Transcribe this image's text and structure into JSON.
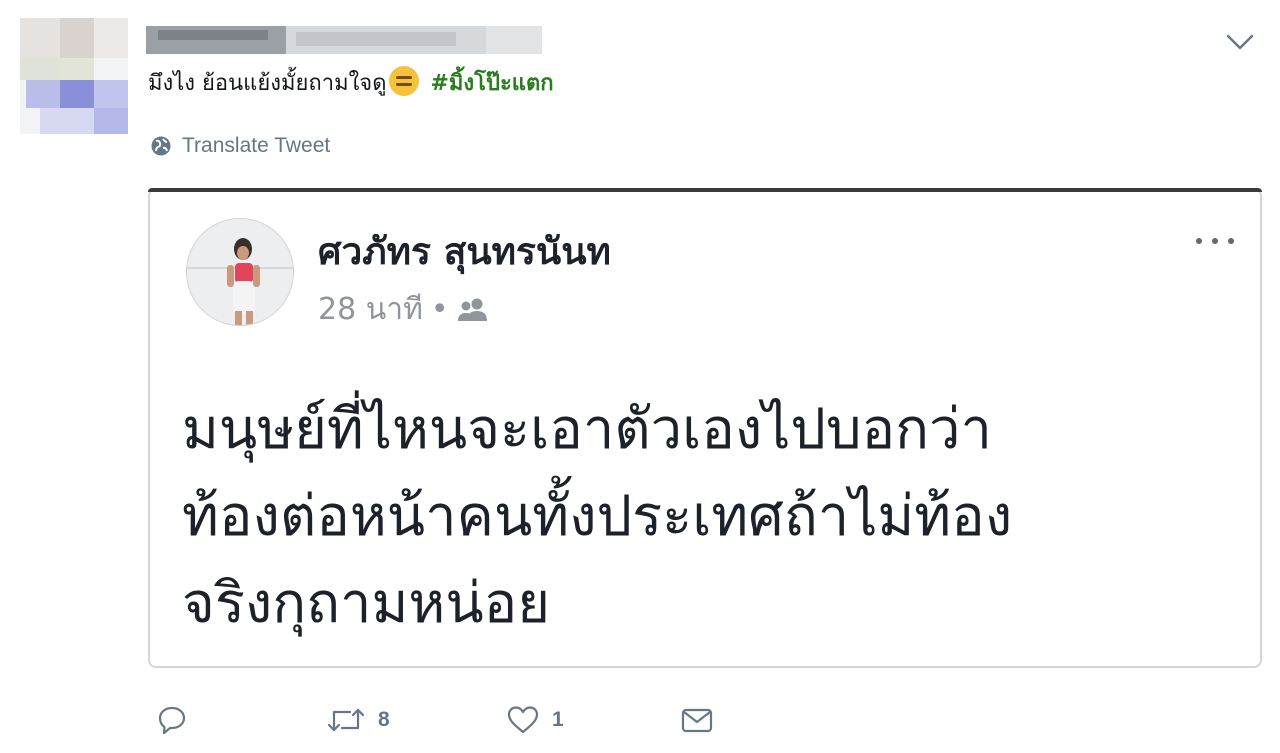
{
  "tweet": {
    "text": "มึงไง ย้อนแย้งมั้ยถามใจดู",
    "emoji": "expressionless-face-emoji",
    "hashtag": "#มิ้งโป๊ะแตก",
    "translate_label": "Translate Tweet"
  },
  "embedded_post": {
    "author_name": "ศวภัทร สุนทรนันท",
    "time": "28 นาที",
    "separator": "•",
    "audience_icon": "friends-icon",
    "body_lines": [
      "มนุษย์ที่ไหนจะเอาตัวเองไปบอกว่า",
      "ท้องต่อหน้าคนทั้งประเทศถ้าไม่ท้อง",
      "จริงกุถามหน่อย"
    ]
  },
  "actions": {
    "reply_count": "",
    "retweet_count": "8",
    "like_count": "1"
  },
  "colors": {
    "text": "#14171a",
    "muted": "#657786",
    "hashtag": "#2a7d1e",
    "fb_muted": "#90949c",
    "card_border": "#d4d6da"
  }
}
